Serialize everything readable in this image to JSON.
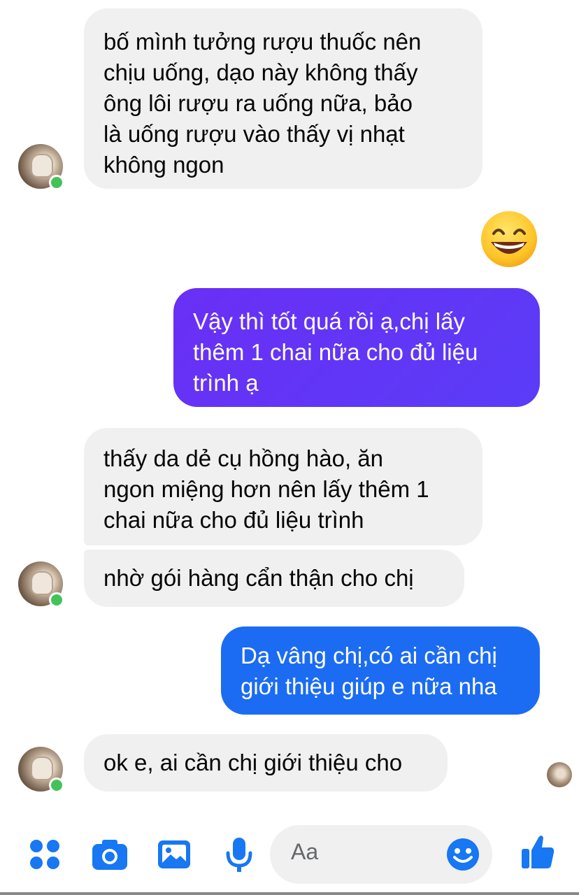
{
  "messages": [
    {
      "from": "them",
      "text": "bố mình tưởng rượu thuốc nên\nchịu uống, dạo này không thấy\nông lôi rượu ra uống nữa, bảo\nlà uống rượu vào thấy vị nhạt\nkhông ngon"
    },
    {
      "from": "me",
      "text": "Vậy thì tốt quá rồi ạ,chị lấy\nthêm 1 chai nữa cho đủ liệu\ntrình ạ"
    },
    {
      "from": "them",
      "text": "thấy da dẻ cụ hồng hào, ăn\nngon miệng hơn nên lấy thêm 1\nchai nữa cho đủ liệu trình"
    },
    {
      "from": "them",
      "text": "nhờ gói hàng cẩn thận cho chị"
    },
    {
      "from": "me",
      "text": "Dạ vâng chị,có ai cần chị\ngiới thiệu giúp e nữa nha"
    },
    {
      "from": "them",
      "text": "ok e, ai cần chị giới thiệu cho"
    }
  ],
  "colors": {
    "incoming_bg": "#f0f0f0",
    "outgoing_purple": "#6a2ff5",
    "outgoing_blue": "#1b6cf2",
    "accent": "#1877f2",
    "online": "#43c25a"
  },
  "composer": {
    "placeholder": "Aa",
    "icons": [
      "menu-dots-icon",
      "camera-icon",
      "gallery-icon",
      "microphone-icon",
      "emoji-icon",
      "like-icon"
    ]
  }
}
